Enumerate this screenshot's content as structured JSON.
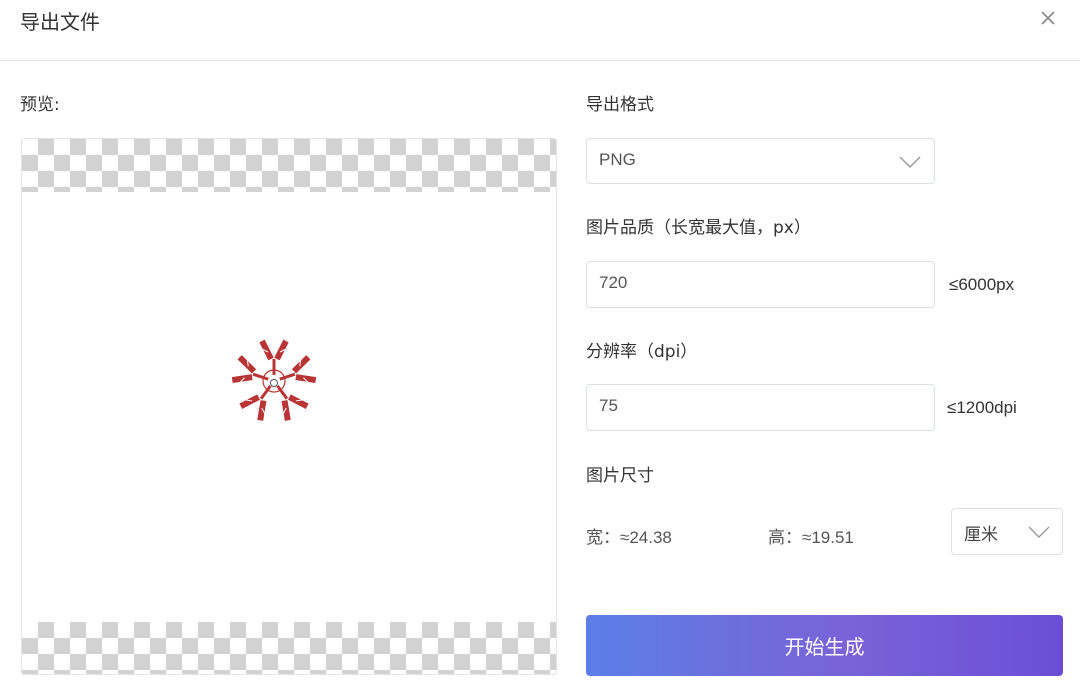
{
  "dialog": {
    "title": "导出文件"
  },
  "preview": {
    "label": "预览:"
  },
  "format": {
    "label": "导出格式",
    "value": "PNG"
  },
  "quality": {
    "label": "图片品质（长宽最大值，px）",
    "value": "720",
    "hint": "≤6000px"
  },
  "resolution": {
    "label": "分辨率（dpi）",
    "value": "75",
    "hint": "≤1200dpi"
  },
  "size": {
    "label": "图片尺寸",
    "width_label": "宽：",
    "width_value": "≈24.38",
    "height_label": "高：",
    "height_value": "≈19.51",
    "unit": "厘米"
  },
  "actions": {
    "generate_label": "开始生成"
  },
  "colors": {
    "antibody": "#b83535",
    "button_start": "#5b7fe6",
    "button_end": "#6a4fd6"
  }
}
